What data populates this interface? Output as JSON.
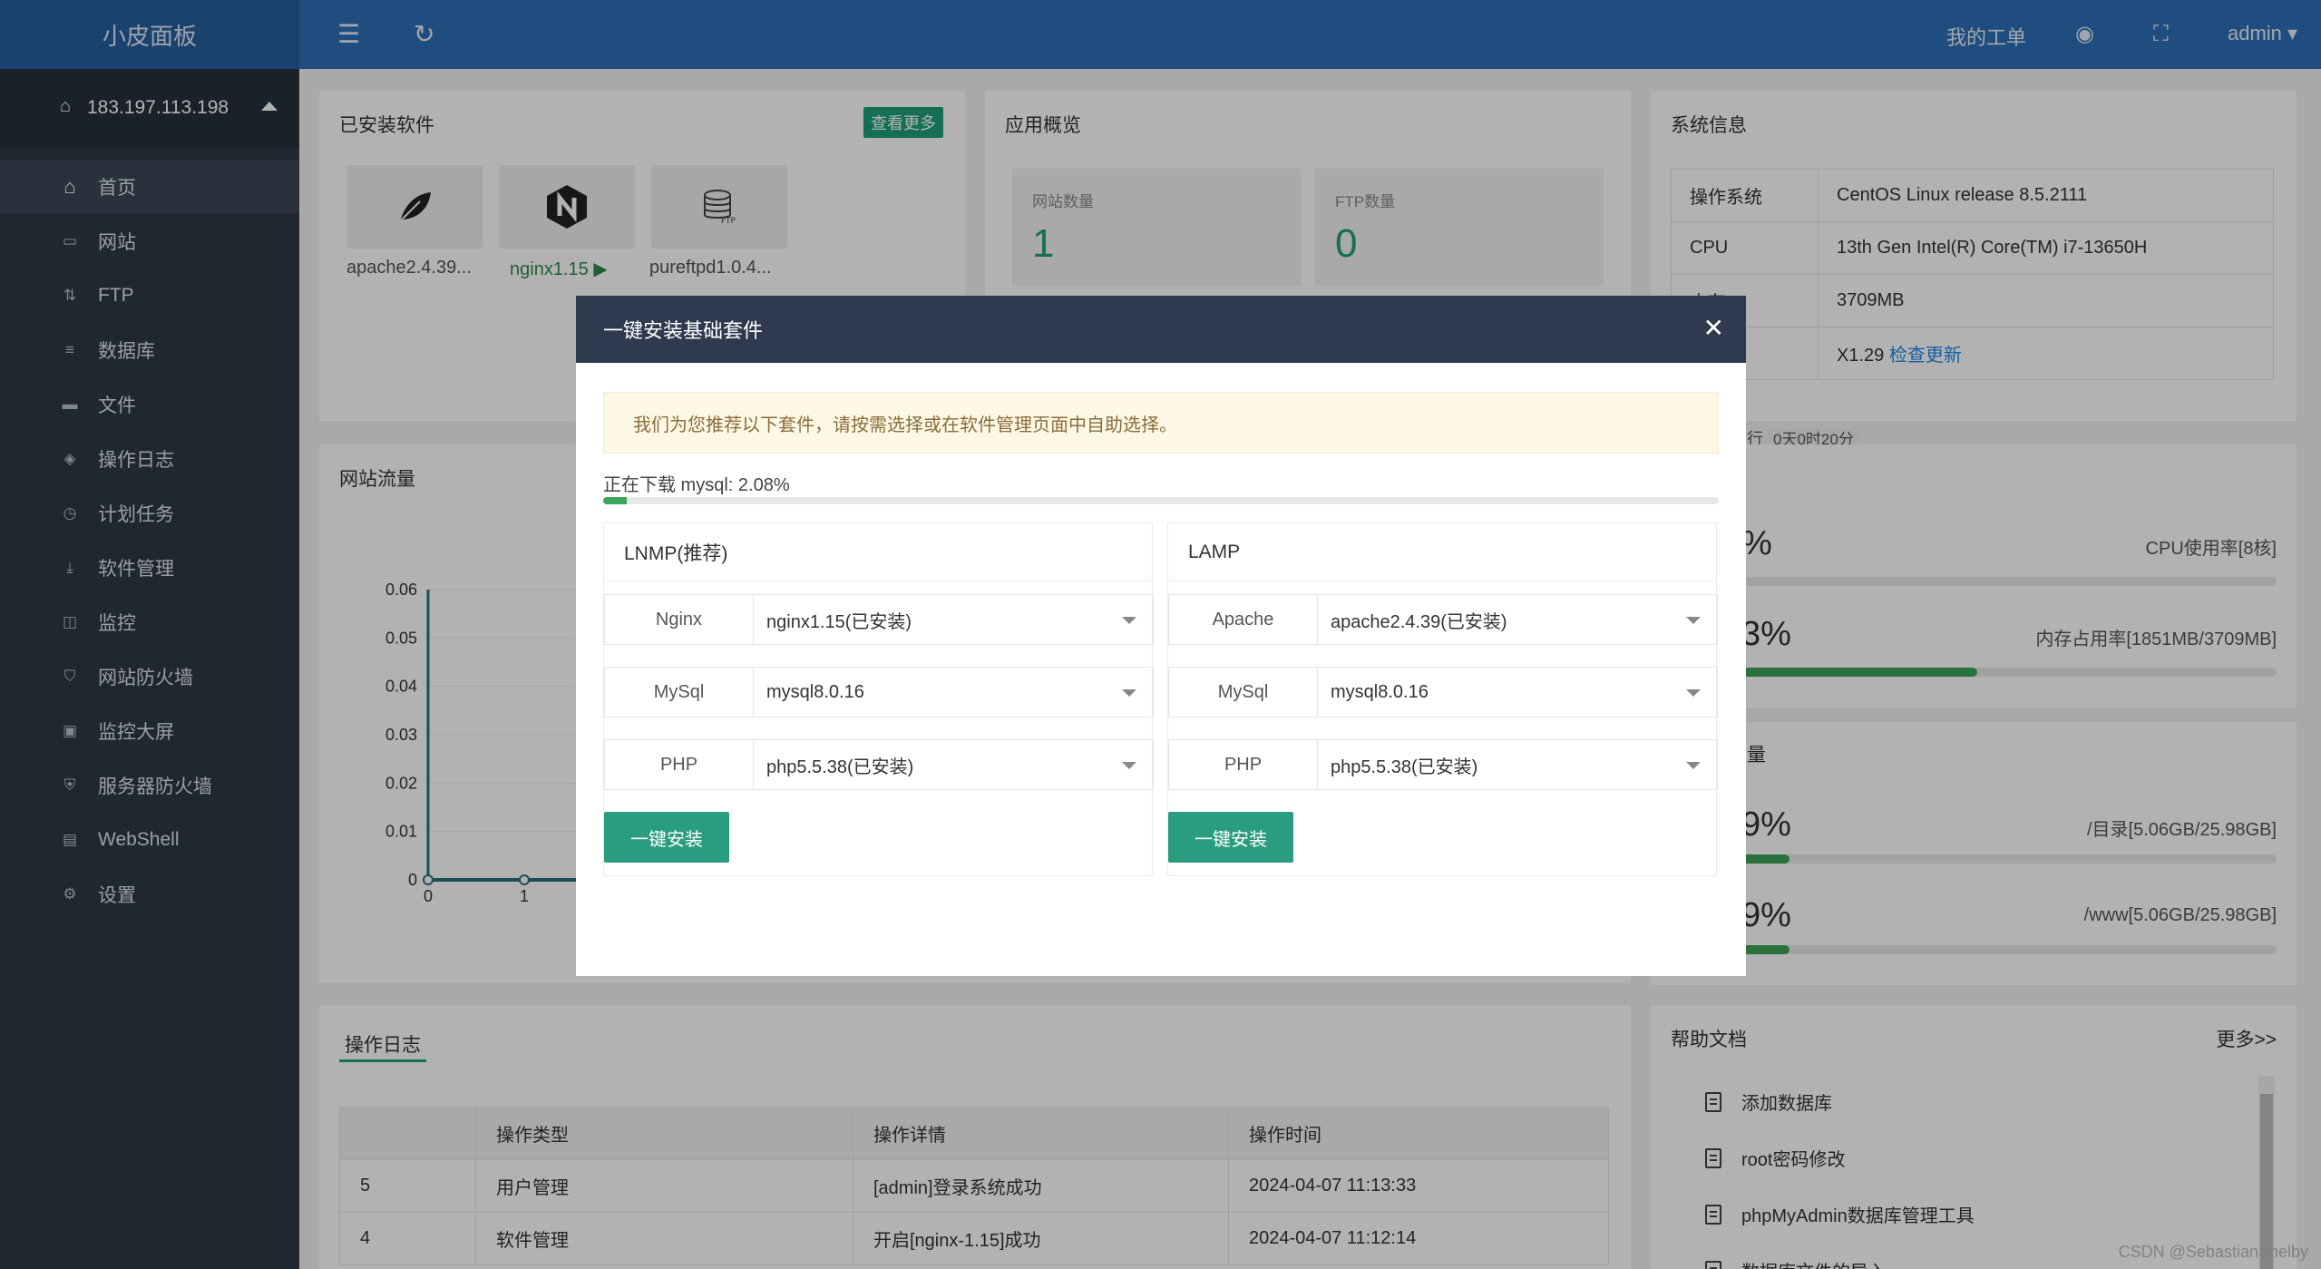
{
  "topbar": {
    "logo": "小皮面板",
    "ticket": "我的工单",
    "user": "admin"
  },
  "sidebar": {
    "server_ip": "183.197.113.198",
    "items": [
      {
        "label": "首页",
        "icon": "home-icon"
      },
      {
        "label": "网站",
        "icon": "monitor-icon"
      },
      {
        "label": "FTP",
        "icon": "ftp-icon"
      },
      {
        "label": "数据库",
        "icon": "database-icon"
      },
      {
        "label": "文件",
        "icon": "folder-icon"
      },
      {
        "label": "操作日志",
        "icon": "layers-icon"
      },
      {
        "label": "计划任务",
        "icon": "clock-icon"
      },
      {
        "label": "软件管理",
        "icon": "download-icon"
      },
      {
        "label": "监控",
        "icon": "chart-icon"
      },
      {
        "label": "网站防火墙",
        "icon": "shield-icon"
      },
      {
        "label": "监控大屏",
        "icon": "screen-icon"
      },
      {
        "label": "服务器防火墙",
        "icon": "shield-icon"
      },
      {
        "label": "WebShell",
        "icon": "terminal-icon"
      },
      {
        "label": "设置",
        "icon": "gear-icon"
      }
    ]
  },
  "installed": {
    "title": "已安装软件",
    "more": "查看更多",
    "items": [
      {
        "name": "apache2.4.39...",
        "icon": "feather-icon"
      },
      {
        "name": "nginx1.15",
        "icon": "nginx-icon",
        "running": "▶"
      },
      {
        "name": "pureftpd1.0.4...",
        "icon": "ftp-database-icon"
      }
    ]
  },
  "overview": {
    "title": "应用概览",
    "sites_label": "网站数量",
    "sites": "1",
    "ftp_label": "FTP数量",
    "ftp": "0"
  },
  "sysinfo": {
    "title": "系统信息",
    "rows": [
      {
        "k": "操作系统",
        "v": "CentOS Linux release 8.5.2111"
      },
      {
        "k": "CPU",
        "v": "13th Gen Intel(R) Core(TM) i7-13650H"
      },
      {
        "k": "内存",
        "v": "3709MB"
      },
      {
        "k": "",
        "v": "X1.29"
      }
    ],
    "update": "检查更新",
    "uptime_label": "行",
    "uptime": "0天0时20分"
  },
  "traffic": {
    "title": "网站流量"
  },
  "chart_data": {
    "type": "line",
    "x": [
      0,
      1
    ],
    "y": [
      0,
      0
    ],
    "ylim": [
      0,
      0.06
    ],
    "yticks": [
      "0.06",
      "0.05",
      "0.04",
      "0.03",
      "0.02",
      "0.01",
      "0"
    ],
    "xticks": [
      "0",
      "1"
    ],
    "color": "#2a6f7f"
  },
  "status": {
    "cpu_pct": "%",
    "cpu_label": "CPU使用率[8核]",
    "cpu_fill": 0,
    "mem_pct": "3%",
    "mem_label": "内存占用率[1851MB/3709MB]",
    "mem_fill": 0.44
  },
  "disk": {
    "title": "量",
    "d1_pct": "9%",
    "d1_label": "/目录[5.06GB/25.98GB]",
    "d1_fill": 0.09,
    "d2_pct": "9%",
    "d2_label": "/www[5.06GB/25.98GB]",
    "d2_fill": 0.09
  },
  "log": {
    "tab": "操作日志",
    "headers": [
      "",
      "操作类型",
      "操作详情",
      "操作时间"
    ],
    "rows": [
      [
        "5",
        "用户管理",
        "[admin]登录系统成功",
        "2024-04-07 11:13:33"
      ],
      [
        "4",
        "软件管理",
        "开启[nginx-1.15]成功",
        "2024-04-07 11:12:14"
      ]
    ]
  },
  "help": {
    "title": "帮助文档",
    "more": "更多>>",
    "items": [
      "添加数据库",
      "root密码修改",
      "phpMyAdmin数据库管理工具",
      "数据库文件的导入"
    ]
  },
  "modal": {
    "title": "一键安装基础套件",
    "notice": "我们为您推荐以下套件，请按需选择或在软件管理页面中自助选择。",
    "download": "正在下载 mysql: 2.08%",
    "progress": 0.0208,
    "lnmp": {
      "title": "LNMP(推荐)",
      "rows": [
        {
          "k": "Nginx",
          "v": "nginx1.15(已安装)"
        },
        {
          "k": "MySql",
          "v": "mysql8.0.16"
        },
        {
          "k": "PHP",
          "v": "php5.5.38(已安装)"
        }
      ],
      "button": "一键安装"
    },
    "lamp": {
      "title": "LAMP",
      "rows": [
        {
          "k": "Apache",
          "v": "apache2.4.39(已安装)"
        },
        {
          "k": "MySql",
          "v": "mysql8.0.16"
        },
        {
          "k": "PHP",
          "v": "php5.5.38(已安装)"
        }
      ],
      "button": "一键安装"
    }
  },
  "watermark": "CSDN @SebastianShelby"
}
